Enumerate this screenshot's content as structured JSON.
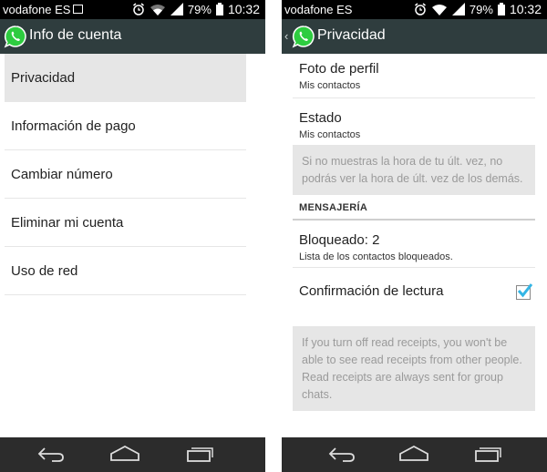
{
  "status_left": {
    "carrier": "vodafone ES",
    "battery": "79%",
    "time": "10:32"
  },
  "status_right": {
    "carrier": "vodafone ES",
    "battery": "79%",
    "time": "10:32"
  },
  "left_screen": {
    "title": "Info de cuenta",
    "items": [
      {
        "label": "Privacidad"
      },
      {
        "label": "Información de pago"
      },
      {
        "label": "Cambiar número"
      },
      {
        "label": "Eliminar mi cuenta"
      },
      {
        "label": "Uso de red"
      }
    ]
  },
  "right_screen": {
    "title": "Privacidad",
    "profile_photo": {
      "title": "Foto de perfil",
      "value": "Mis contactos"
    },
    "status": {
      "title": "Estado",
      "value": "Mis contactos"
    },
    "last_seen_note": "Si no muestras la hora de tu últ. vez, no podrás ver la hora de últ. vez de los demás.",
    "messaging_header": "MENSAJERÍA",
    "blocked": {
      "title": "Bloqueado: 2",
      "subtitle": "Lista de los contactos bloqueados."
    },
    "read_receipts": {
      "title": "Confirmación de lectura",
      "checked": true
    },
    "read_receipts_note": "If you turn off read receipts, you won't be able to see read receipts from other people. Read receipts are always sent for group chats."
  },
  "icons": {
    "app": "whatsapp-logo-icon",
    "alarm": "alarm-icon",
    "wifi": "wifi-icon",
    "signal": "signal-icon",
    "battery": "battery-icon",
    "nav_back": "back-icon",
    "nav_home": "home-icon",
    "nav_recents": "recents-icon"
  },
  "colors": {
    "action_bar": "#2f3d3e",
    "accent_check": "#33b5e5",
    "whatsapp_green": "#2ecc40"
  }
}
